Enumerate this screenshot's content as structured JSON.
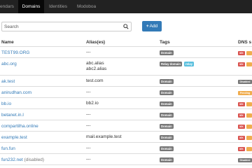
{
  "nav": {
    "items": [
      {
        "label": "endars",
        "active": false
      },
      {
        "label": "Domains",
        "active": true
      },
      {
        "label": "Identities",
        "active": false
      },
      {
        "label": "Modoboa",
        "active": false
      }
    ]
  },
  "search": {
    "placeholder": "Search",
    "value": ""
  },
  "add_button": {
    "label": "Add"
  },
  "table": {
    "headers": {
      "name": "Name",
      "aliases": "Alias(es)",
      "tags": "Tags",
      "dns": "DNS s"
    },
    "rows": [
      {
        "name": "TEST99.ORG",
        "suffix": "",
        "aliases": [
          "---"
        ],
        "tags": [
          "Domain"
        ],
        "dns": "mx-red"
      },
      {
        "name": "abc.org",
        "suffix": "",
        "aliases": [
          "abc.alias",
          "abc2.alias"
        ],
        "tags": [
          "Relay domain",
          "relay"
        ],
        "dns": "mx-red"
      },
      {
        "name": "ak.test",
        "suffix": "",
        "aliases": [
          "test.com"
        ],
        "tags": [
          "Domain"
        ],
        "dns": "disabled"
      },
      {
        "name": "anirudhan.com",
        "suffix": "",
        "aliases": [
          "---"
        ],
        "tags": [
          "Domain"
        ],
        "dns": "pending"
      },
      {
        "name": "bb.io",
        "suffix": "",
        "aliases": [
          "bb2.io"
        ],
        "tags": [
          "Domain"
        ],
        "dns": "mx-red"
      },
      {
        "name": "betanet.in.l",
        "suffix": "",
        "aliases": [
          "---"
        ],
        "tags": [
          "Domain"
        ],
        "dns": "mx-red"
      },
      {
        "name": "compartilha.online",
        "suffix": "",
        "aliases": [
          "---"
        ],
        "tags": [
          "Domain"
        ],
        "dns": "mx-red"
      },
      {
        "name": "example.test",
        "suffix": "",
        "aliases": [
          "mail.example.test"
        ],
        "tags": [
          "Domain"
        ],
        "dns": "mx-red"
      },
      {
        "name": "fun.fun",
        "suffix": "",
        "aliases": [
          "---"
        ],
        "tags": [
          "Domain"
        ],
        "dns": "mx-red"
      },
      {
        "name": "fun232.net",
        "suffix": " (disabled)",
        "aliases": [
          "---"
        ],
        "tags": [
          "Domain"
        ],
        "dns": "disabled"
      }
    ],
    "dns_labels": {
      "mx": "MX",
      "disabled": "Disabled",
      "pending": "Pending"
    }
  },
  "colors": {
    "navbar": "#222222",
    "nav_active": "#080808",
    "primary": "#337ab7",
    "tag_default": "#777777",
    "tag_info": "#5bc0de",
    "dns_danger": "#d9534f",
    "dns_warning": "#f0ad4e"
  },
  "icons": {
    "search": "search-icon",
    "add": "plus-icon"
  }
}
